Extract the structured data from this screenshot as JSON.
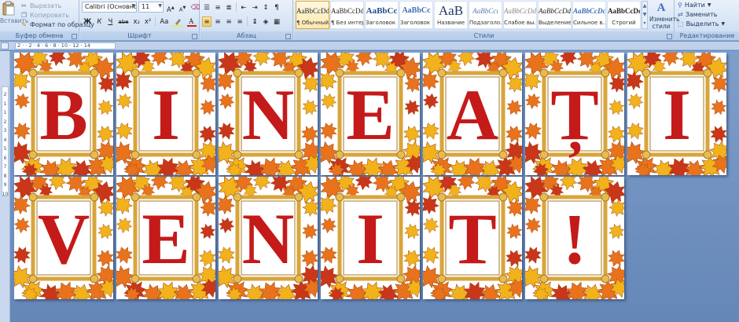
{
  "ribbon": {
    "clipboard": {
      "paste_label": "Вставить",
      "cut": "Вырезать",
      "copy": "Копировать",
      "format_painter": "Формат по образцу",
      "group_label": "Буфер обмена"
    },
    "font": {
      "family": "Calibri (Основной тек",
      "size": "11",
      "group_label": "Шрифт",
      "grow": "A",
      "shrink": "A",
      "bold": "Ж",
      "italic": "К",
      "underline": "Ч",
      "strike": "abe",
      "subscript": "x₂",
      "superscript": "x²",
      "case": "Aa",
      "highlight_color": "#f5e642",
      "font_color": "#d02020"
    },
    "paragraph": {
      "group_label": "Абзац",
      "pilcrow": "¶"
    },
    "styles": {
      "group_label": "Стили",
      "items": [
        {
          "preview": "AaBbCcDd",
          "name": "¶ Обычный",
          "selected": true
        },
        {
          "preview": "AaBbCcDd",
          "name": "¶ Без интер...",
          "selected": false
        },
        {
          "preview": "AaBbCc",
          "name": "Заголовок 1",
          "selected": false
        },
        {
          "preview": "AaBbCc",
          "name": "Заголовок 2",
          "selected": false
        },
        {
          "preview": "AaB",
          "name": "Название",
          "selected": false
        },
        {
          "preview": "AaBbCcı",
          "name": "Подзаголо...",
          "selected": false
        },
        {
          "preview": "AaBbCcDd",
          "name": "Слабое вы...",
          "selected": false
        },
        {
          "preview": "AaBbCcDd",
          "name": "Выделение",
          "selected": false
        },
        {
          "preview": "AaBbCcDc",
          "name": "Сильное в...",
          "selected": false
        },
        {
          "preview": "AaBbCcDc",
          "name": "Строгий",
          "selected": false
        }
      ],
      "change_styles": "Изменить стили"
    },
    "editing": {
      "group_label": "Редактирование",
      "find": "Найти",
      "replace": "Заменить",
      "select": "Выделить"
    }
  },
  "ruler": {
    "ticks": "2 · · 2 · 4 · 6 · 8 · 10 · 12 · 14",
    "vertical": [
      "2",
      "1",
      "1",
      "2",
      "3",
      "4",
      "5",
      "6",
      "7",
      "8",
      "9",
      "10"
    ]
  },
  "pages": [
    {
      "letter": "B"
    },
    {
      "letter": "I"
    },
    {
      "letter": "N"
    },
    {
      "letter": "E"
    },
    {
      "letter": "A"
    },
    {
      "letter": "Ț"
    },
    {
      "letter": "I"
    },
    {
      "letter": "V"
    },
    {
      "letter": "E"
    },
    {
      "letter": "N"
    },
    {
      "letter": "I"
    },
    {
      "letter": "T"
    },
    {
      "letter": "!"
    }
  ],
  "colors": {
    "letter": "#c41a1a",
    "leaf_orange": "#e8731c",
    "leaf_yellow": "#f2b21b",
    "leaf_red": "#c9361a",
    "frame_gold": "#d8a53a"
  }
}
